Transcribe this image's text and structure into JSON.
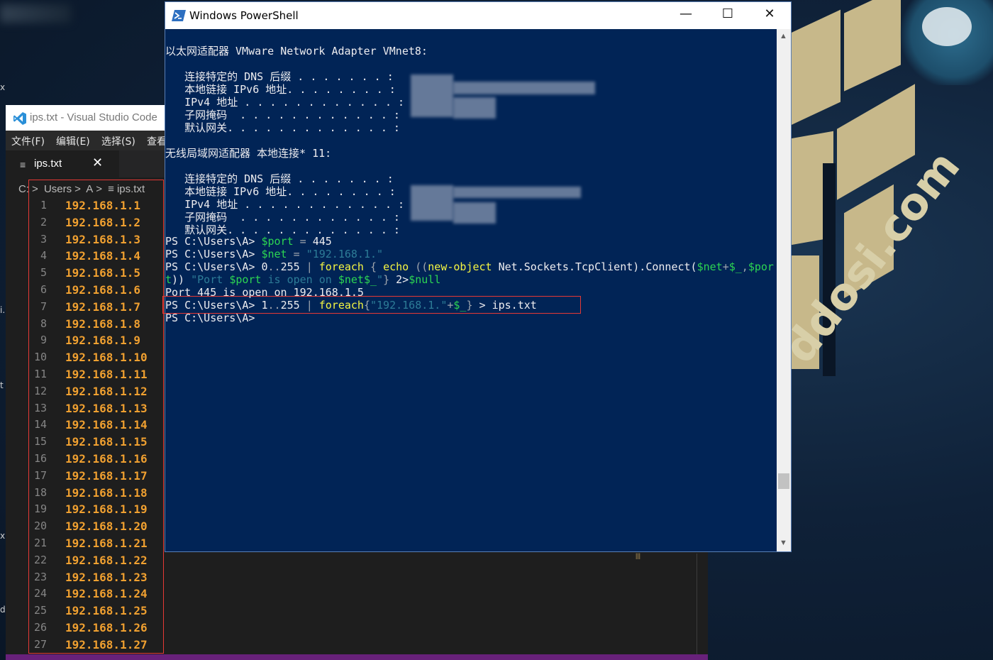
{
  "desktop": {
    "watermark_text": "ddosi.com",
    "edge_chars": [
      "x",
      "i.",
      "t",
      "x",
      "d"
    ]
  },
  "vscode": {
    "title": "ips.txt - Visual Studio Code",
    "menu": [
      "文件(F)",
      "编辑(E)",
      "选择(S)",
      "查看"
    ],
    "tab": {
      "icon": "lines-icon",
      "label": "ips.txt",
      "close": "✕"
    },
    "breadcrumb": [
      "C:",
      ">",
      "Users",
      ">",
      "A",
      ">",
      "≡",
      "ips.txt"
    ],
    "lines": [
      {
        "num": "1",
        "text": "192.168.1.1"
      },
      {
        "num": "2",
        "text": "192.168.1.2"
      },
      {
        "num": "3",
        "text": "192.168.1.3"
      },
      {
        "num": "4",
        "text": "192.168.1.4"
      },
      {
        "num": "5",
        "text": "192.168.1.5"
      },
      {
        "num": "6",
        "text": "192.168.1.6"
      },
      {
        "num": "7",
        "text": "192.168.1.7"
      },
      {
        "num": "8",
        "text": "192.168.1.8"
      },
      {
        "num": "9",
        "text": "192.168.1.9"
      },
      {
        "num": "10",
        "text": "192.168.1.10"
      },
      {
        "num": "11",
        "text": "192.168.1.11"
      },
      {
        "num": "12",
        "text": "192.168.1.12"
      },
      {
        "num": "13",
        "text": "192.168.1.13"
      },
      {
        "num": "14",
        "text": "192.168.1.14"
      },
      {
        "num": "15",
        "text": "192.168.1.15"
      },
      {
        "num": "16",
        "text": "192.168.1.16"
      },
      {
        "num": "17",
        "text": "192.168.1.17"
      },
      {
        "num": "18",
        "text": "192.168.1.18"
      },
      {
        "num": "19",
        "text": "192.168.1.19"
      },
      {
        "num": "20",
        "text": "192.168.1.20"
      },
      {
        "num": "21",
        "text": "192.168.1.21"
      },
      {
        "num": "22",
        "text": "192.168.1.22"
      },
      {
        "num": "23",
        "text": "192.168.1.23"
      },
      {
        "num": "24",
        "text": "192.168.1.24"
      },
      {
        "num": "25",
        "text": "192.168.1.25"
      },
      {
        "num": "26",
        "text": "192.168.1.26"
      },
      {
        "num": "27",
        "text": "192.168.1.27"
      }
    ]
  },
  "powershell": {
    "title": "Windows PowerShell",
    "controls": {
      "minimize": "—",
      "maximize": "☐",
      "close": "✕"
    },
    "lines": [
      [
        {
          "t": "以太网适配器 VMware Network Adapter VMnet8:",
          "c": ""
        }
      ],
      [
        {
          "t": "",
          "c": ""
        }
      ],
      [
        {
          "t": "   连接特定的 DNS 后缀 . . . . . . . :",
          "c": ""
        }
      ],
      [
        {
          "t": "   本地链接 IPv6 地址. . . . . . . . :",
          "c": ""
        }
      ],
      [
        {
          "t": "   IPv4 地址 . . . . . . . . . . . . :",
          "c": ""
        }
      ],
      [
        {
          "t": "   子网掩码  . . . . . . . . . . . . :",
          "c": ""
        }
      ],
      [
        {
          "t": "   默认网关. . . . . . . . . . . . . :",
          "c": ""
        }
      ],
      [
        {
          "t": "",
          "c": ""
        }
      ],
      [
        {
          "t": "无线局域网适配器 本地连接* 11:",
          "c": ""
        }
      ],
      [
        {
          "t": "",
          "c": ""
        }
      ],
      [
        {
          "t": "   连接特定的 DNS 后缀 . . . . . . . :",
          "c": ""
        }
      ],
      [
        {
          "t": "   本地链接 IPv6 地址. . . . . . . . :",
          "c": ""
        }
      ],
      [
        {
          "t": "   IPv4 地址 . . . . . . . . . . . . :",
          "c": ""
        }
      ],
      [
        {
          "t": "   子网掩码  . . . . . . . . . . . . :",
          "c": ""
        }
      ],
      [
        {
          "t": "   默认网关. . . . . . . . . . . . . :",
          "c": ""
        }
      ],
      [
        {
          "t": "PS C:\\Users\\A> ",
          "c": ""
        },
        {
          "t": "$port",
          "c": "var"
        },
        {
          "t": " = ",
          "c": "op"
        },
        {
          "t": "445",
          "c": ""
        }
      ],
      [
        {
          "t": "PS C:\\Users\\A> ",
          "c": ""
        },
        {
          "t": "$net",
          "c": "var"
        },
        {
          "t": " = ",
          "c": "op"
        },
        {
          "t": "\"192.168.1.\"",
          "c": "str"
        }
      ],
      [
        {
          "t": "PS C:\\Users\\A> ",
          "c": ""
        },
        {
          "t": "0",
          "c": ""
        },
        {
          "t": "..",
          "c": "op"
        },
        {
          "t": "255 ",
          "c": ""
        },
        {
          "t": "| ",
          "c": "op"
        },
        {
          "t": "foreach",
          "c": "kw"
        },
        {
          "t": " { ",
          "c": "op"
        },
        {
          "t": "echo",
          "c": "kw"
        },
        {
          "t": " ((",
          "c": "op"
        },
        {
          "t": "new-object",
          "c": "kw"
        },
        {
          "t": " Net.Sockets.TcpClient).Connect(",
          "c": ""
        },
        {
          "t": "$net",
          "c": "var"
        },
        {
          "t": "+",
          "c": "op"
        },
        {
          "t": "$_",
          "c": "var"
        },
        {
          "t": ",",
          "c": "op"
        },
        {
          "t": "$por",
          "c": "var"
        }
      ],
      [
        {
          "t": "t",
          "c": "var"
        },
        {
          "t": ")) ",
          "c": ""
        },
        {
          "t": "\"Port ",
          "c": "str"
        },
        {
          "t": "$port",
          "c": "var"
        },
        {
          "t": " is open on ",
          "c": "str"
        },
        {
          "t": "$net$_",
          "c": "var"
        },
        {
          "t": "\"",
          "c": "str"
        },
        {
          "t": "} ",
          "c": "op"
        },
        {
          "t": "2>",
          "c": ""
        },
        {
          "t": "$null",
          "c": "var"
        }
      ],
      [
        {
          "t": "Port 445 is open on 192.168.1.5",
          "c": ""
        }
      ],
      [
        {
          "t": "PS C:\\Users\\A> ",
          "c": ""
        },
        {
          "t": "1",
          "c": ""
        },
        {
          "t": "..",
          "c": "op"
        },
        {
          "t": "255 ",
          "c": ""
        },
        {
          "t": "| ",
          "c": "op"
        },
        {
          "t": "foreach",
          "c": "kw"
        },
        {
          "t": "{",
          "c": "op"
        },
        {
          "t": "\"192.168.1.\"",
          "c": "str"
        },
        {
          "t": "+",
          "c": "op"
        },
        {
          "t": "$_",
          "c": "var"
        },
        {
          "t": "} ",
          "c": "op"
        },
        {
          "t": "> ips.txt",
          "c": ""
        }
      ],
      [
        {
          "t": "PS C:\\Users\\A>",
          "c": ""
        }
      ]
    ]
  },
  "colors": {
    "ps_background": "#012456",
    "ps_var": "#2cd552",
    "ps_string": "#2d7c97",
    "ps_keyword": "#f5f542",
    "editor_text": "#f0a030",
    "highlight_box": "#e53935",
    "vscode_statusbar": "#68217a"
  }
}
